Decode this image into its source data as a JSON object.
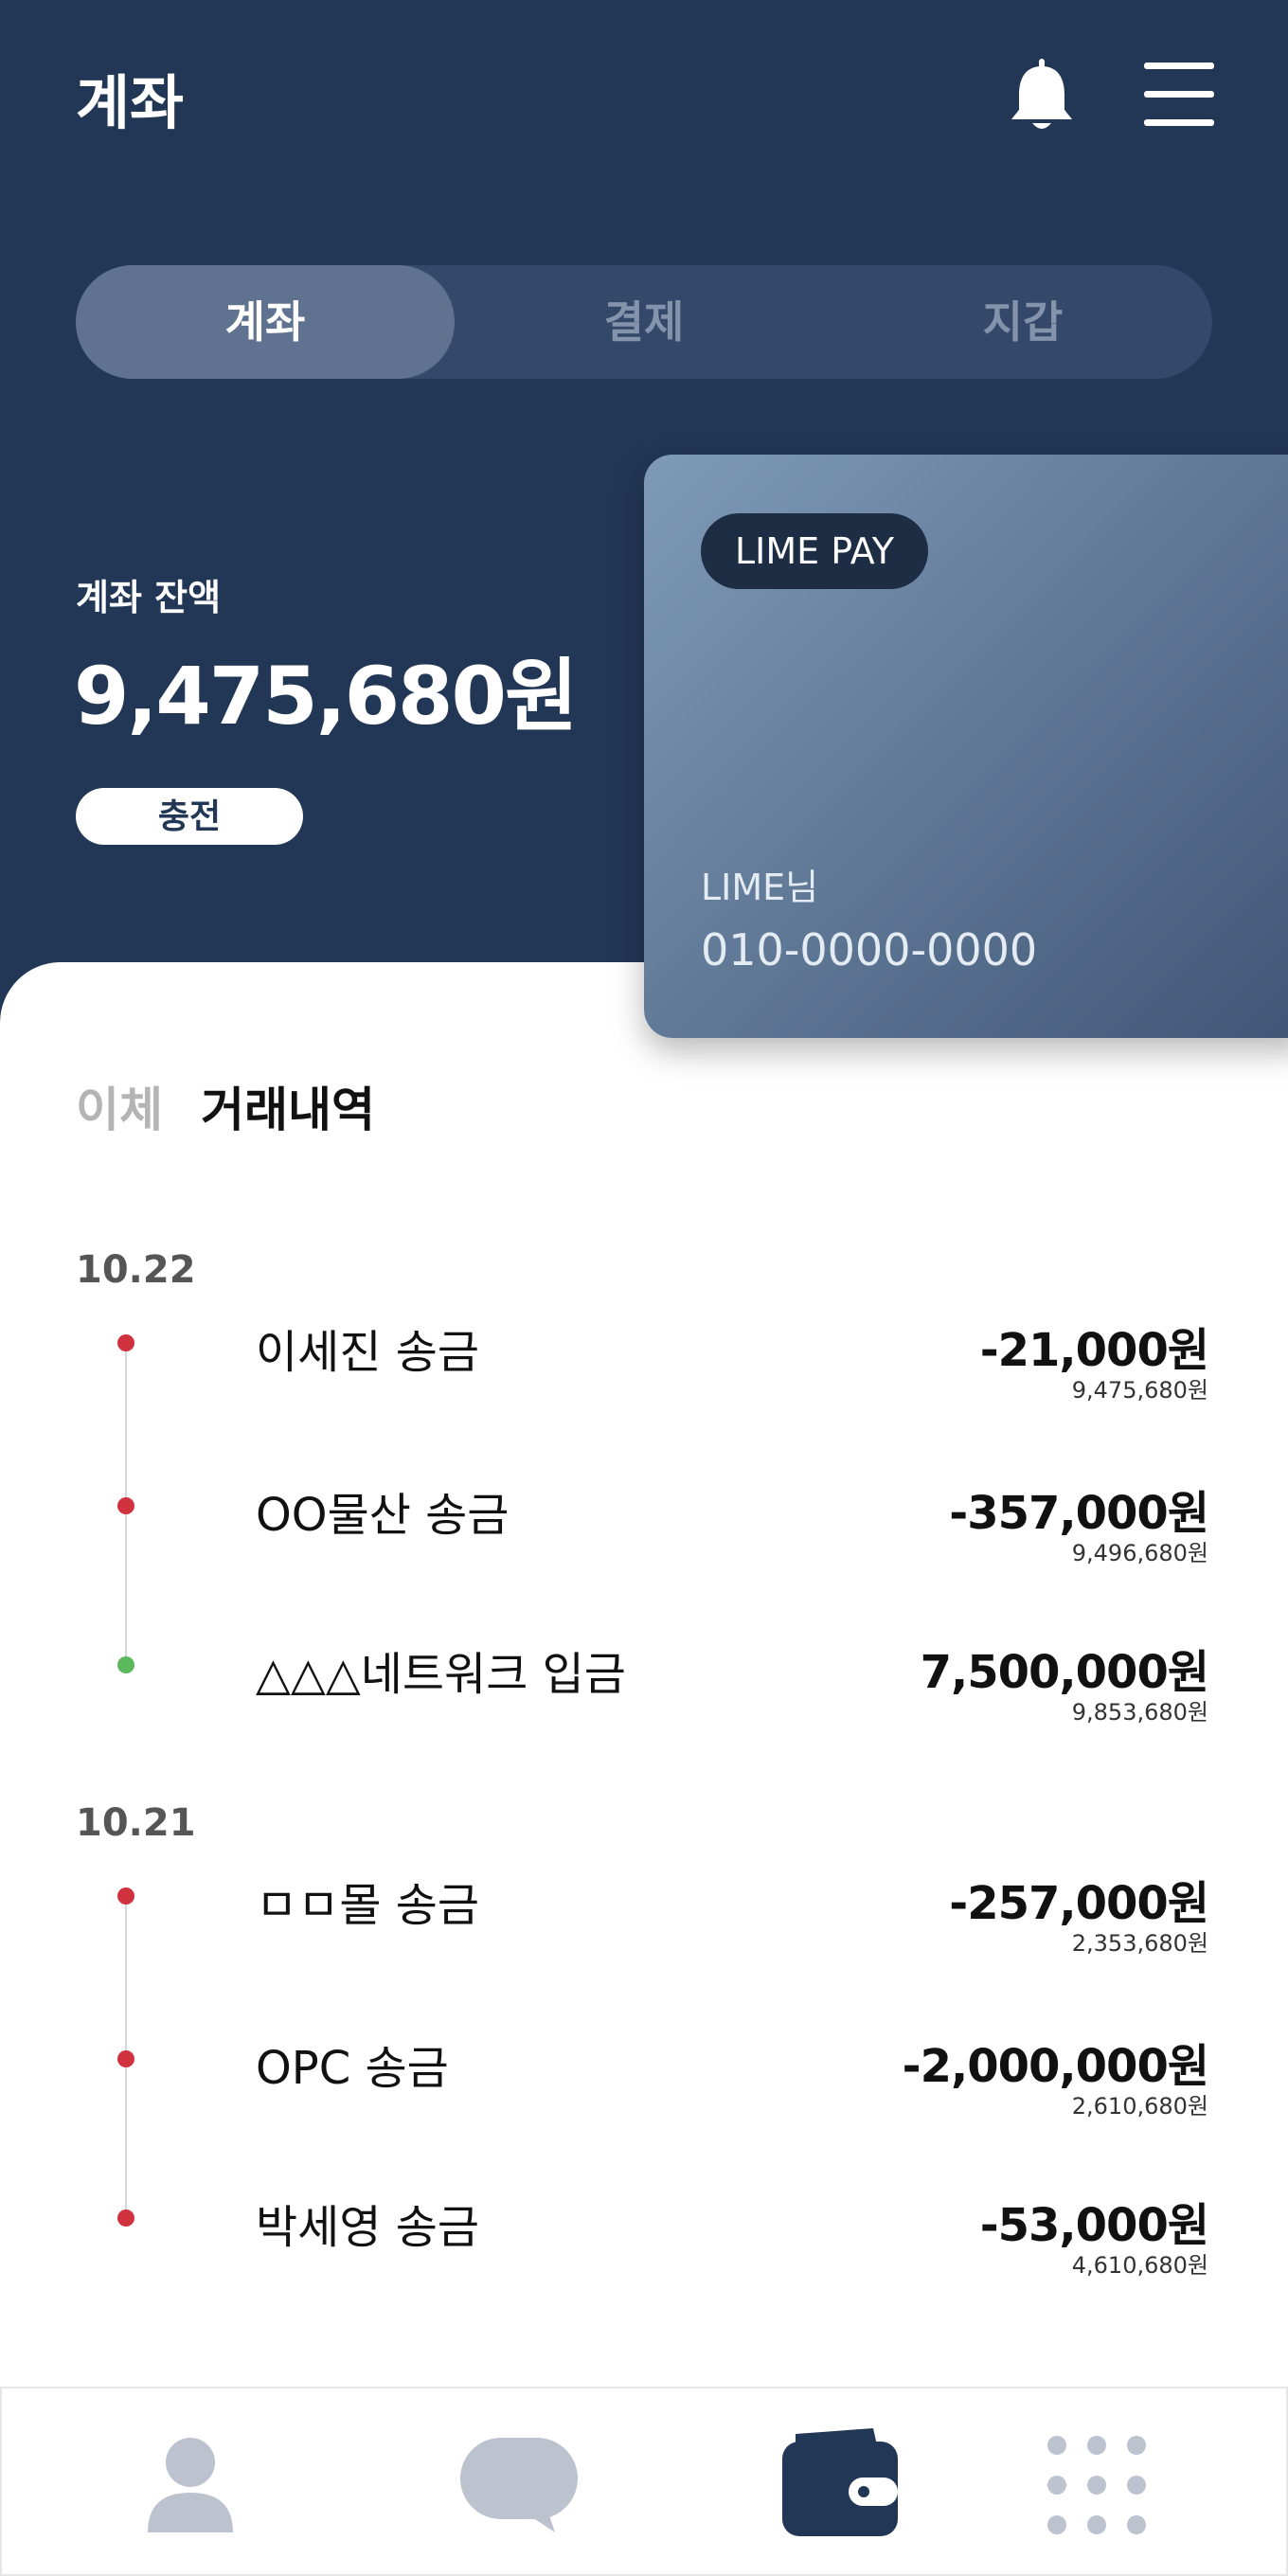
{
  "header": {
    "title": "계좌",
    "icons": {
      "notifications": "bell-icon",
      "menu": "hamburger-menu-icon"
    }
  },
  "segment_tabs": [
    {
      "label": "계좌",
      "active": true
    },
    {
      "label": "결제",
      "active": false
    },
    {
      "label": "지갑",
      "active": false
    }
  ],
  "balance": {
    "label": "계좌 잔액",
    "amount": "9,475,680원",
    "charge_label": "충전"
  },
  "card": {
    "badge": "LIME PAY",
    "owner": "LIME님",
    "phone": "010-0000-0000"
  },
  "sub_tabs": [
    {
      "label": "이체",
      "active": false
    },
    {
      "label": "거래내역",
      "active": true
    }
  ],
  "transactions": [
    {
      "date": "10.22",
      "items": [
        {
          "name": "이세진 송금",
          "amount": "-21,000원",
          "balance": "9,475,680원",
          "type": "withdrawal"
        },
        {
          "name": "OO물산 송금",
          "amount": "-357,000원",
          "balance": "9,496,680원",
          "type": "withdrawal"
        },
        {
          "name": "△△△네트워크 입금",
          "amount": "7,500,000원",
          "balance": "9,853,680원",
          "type": "deposit"
        }
      ]
    },
    {
      "date": "10.21",
      "items": [
        {
          "name": "ㅁㅁ몰 송금",
          "amount": "-257,000원",
          "balance": "2,353,680원",
          "type": "withdrawal"
        },
        {
          "name": "OPC 송금",
          "amount": "-2,000,000원",
          "balance": "2,610,680원",
          "type": "withdrawal"
        },
        {
          "name": "박세영 송금",
          "amount": "-53,000원",
          "balance": "4,610,680원",
          "type": "withdrawal"
        }
      ]
    }
  ],
  "bottom_nav": [
    {
      "icon": "profile-icon",
      "active": false
    },
    {
      "icon": "chat-icon",
      "active": false
    },
    {
      "icon": "wallet-icon",
      "active": true
    },
    {
      "icon": "grid-menu-icon",
      "active": false
    }
  ],
  "colors": {
    "header_bg": "#223756",
    "withdrawal_dot": "#d0333f",
    "deposit_dot": "#5cb85c",
    "nav_active": "#223756",
    "nav_inactive": "#bcc3ce"
  }
}
